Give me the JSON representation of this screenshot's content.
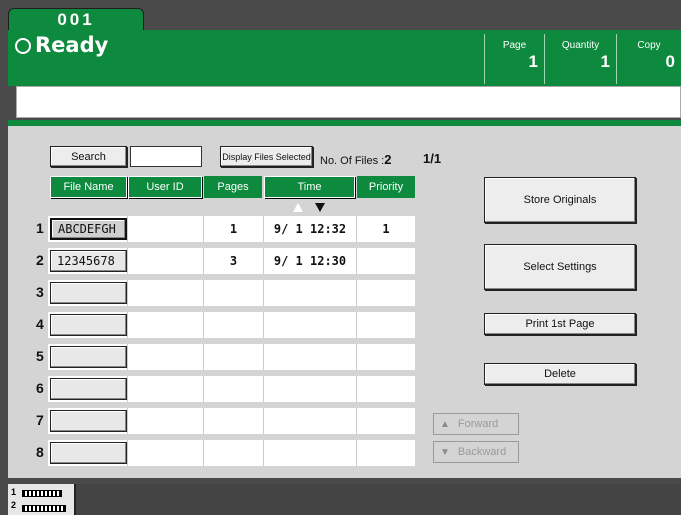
{
  "tab": {
    "label": "001"
  },
  "status": {
    "text": "Ready"
  },
  "counters": [
    {
      "label": "Page",
      "value": "1"
    },
    {
      "label": "Quantity",
      "value": "1"
    },
    {
      "label": "Copy",
      "value": "0"
    }
  ],
  "message": "",
  "toolbar": {
    "search_label": "Search",
    "search_value": "",
    "display_files_selected_label": "Display Files Selected",
    "num_files_label": "No. Of Files :",
    "num_files_value": "2",
    "page_indicator": "1/1"
  },
  "table": {
    "headers": {
      "file_name": "File Name",
      "user_id": "User ID",
      "pages": "Pages",
      "time": "Time",
      "priority": "Priority"
    },
    "rows": [
      {
        "num": "1",
        "file_name": "ABCDEFGH",
        "user_id": "",
        "pages": "1",
        "time": "9/ 1 12:32",
        "priority": "1"
      },
      {
        "num": "2",
        "file_name": "12345678",
        "user_id": "",
        "pages": "3",
        "time": "9/ 1 12:30",
        "priority": ""
      },
      {
        "num": "3",
        "file_name": "",
        "user_id": "",
        "pages": "",
        "time": "",
        "priority": ""
      },
      {
        "num": "4",
        "file_name": "",
        "user_id": "",
        "pages": "",
        "time": "",
        "priority": ""
      },
      {
        "num": "5",
        "file_name": "",
        "user_id": "",
        "pages": "",
        "time": "",
        "priority": ""
      },
      {
        "num": "6",
        "file_name": "",
        "user_id": "",
        "pages": "",
        "time": "",
        "priority": ""
      },
      {
        "num": "7",
        "file_name": "",
        "user_id": "",
        "pages": "",
        "time": "",
        "priority": ""
      },
      {
        "num": "8",
        "file_name": "",
        "user_id": "",
        "pages": "",
        "time": "",
        "priority": ""
      }
    ]
  },
  "actions": {
    "store_originals": "Store Originals",
    "select_settings": "Select Settings",
    "print_first_page": "Print 1st Page",
    "delete": "Delete"
  },
  "nav": {
    "forward": "Forward",
    "backward": "Backward"
  },
  "trays": {
    "tray1": "1",
    "tray2": "2"
  },
  "colors": {
    "accent": "#0d8a3e",
    "panel": "#d4d4d4",
    "frame": "#4a4a4a"
  }
}
